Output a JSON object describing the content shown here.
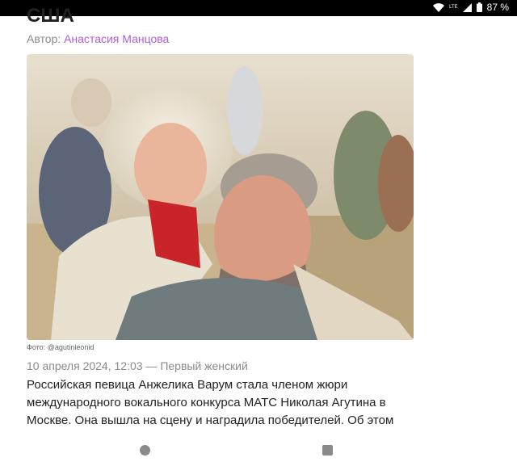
{
  "status": {
    "battery": "87 %",
    "network": "LTE"
  },
  "article": {
    "title": "США",
    "author_prefix": "Автор:",
    "author_name": "Анастасия Манцова",
    "photo_alt": "Анжелика Варум и Леонид Агутин",
    "photo_credit": "Фото: @agutinleonid",
    "dateline": "10 апреля 2024, 12:03 — Первый женский",
    "body": "Российская певица Анжелика Варум стала членом жюри международного вокального конкурса МАТС Николая Агутина в Москве. Она вышла на сцену и наградила победителей. Об этом"
  },
  "colors": {
    "accent": "#b25ad9",
    "muted": "#8a8a8a",
    "text": "#222222"
  },
  "navbar": {
    "home_icon": "circle-home-icon",
    "recents_icon": "square-recents-icon"
  }
}
